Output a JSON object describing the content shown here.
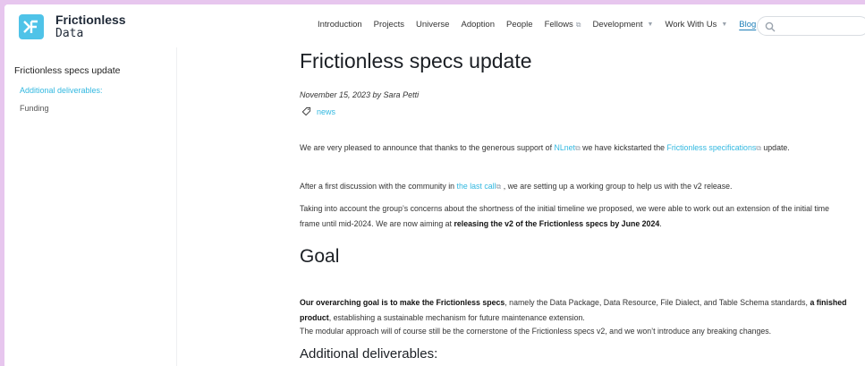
{
  "brand": {
    "name": "Frictionless",
    "sub": "Data"
  },
  "nav": {
    "items": [
      {
        "label": "Introduction"
      },
      {
        "label": "Projects"
      },
      {
        "label": "Universe"
      },
      {
        "label": "Adoption"
      },
      {
        "label": "People"
      },
      {
        "label": "Fellows",
        "external": true
      },
      {
        "label": "Development",
        "dropdown": true
      },
      {
        "label": "Work With Us",
        "dropdown": true
      },
      {
        "label": "Blog",
        "active": true
      }
    ],
    "search_placeholder": ""
  },
  "sidebar": {
    "title": "Frictionless specs update",
    "items": [
      {
        "label": "Additional deliverables:",
        "active": true
      },
      {
        "label": "Funding"
      }
    ]
  },
  "article": {
    "title": "Frictionless specs update",
    "byline": "November 15, 2023 by Sara Petti",
    "tag": "news",
    "p1": {
      "t1": "We are very pleased to announce that thanks to the generous support of ",
      "link1": "NLnet",
      "t2": " we have kickstarted the ",
      "link2": "Frictionless specifications",
      "t3": " update."
    },
    "p2": {
      "t1": "After a first discussion with the community in ",
      "link1": "the last call",
      "t2": " , we are setting up a working group to help us with the v2 release."
    },
    "p3": {
      "t1": "Taking into account the group’s concerns about the shortness of the initial timeline we proposed, we were able to work out an extension of the initial time frame until mid-2024. We are now aiming at ",
      "bold": "releasing the v2 of the Frictionless specs by June 2024",
      "t2": "."
    },
    "goal_heading": "Goal",
    "p4": {
      "bold1": "Our overarching goal is to make the Frictionless specs",
      "t1": ", namely the Data Package, Data Resource, File Dialect, and Table Schema standards, ",
      "bold2": "a finished product",
      "t2": ", establishing a sustainable mechanism for future maintenance extension."
    },
    "p5": "The modular approach will of course still be the cornerstone of the Frictionless specs v2, and we won’t introduce any breaking changes.",
    "deliverables_heading": "Additional deliverables:"
  },
  "colors": {
    "accent": "#32b8e0",
    "logo": "#4fc3e8",
    "frame": "#e7c6ee"
  },
  "icons": {
    "external": "external-link-icon",
    "caret": "chevron-down-icon",
    "search": "search-icon",
    "tag": "tag-icon"
  }
}
